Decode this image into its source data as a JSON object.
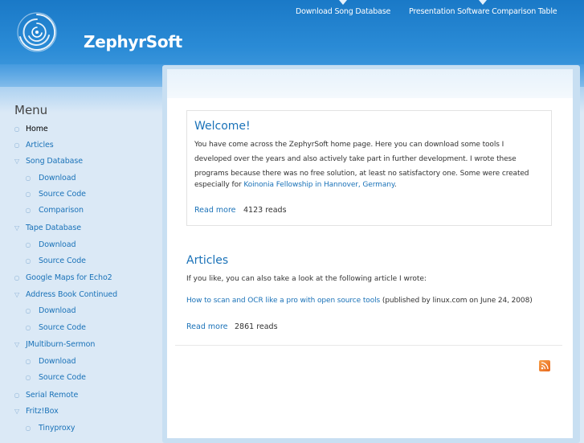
{
  "header": {
    "site_name": "ZephyrSoft",
    "logo_icon": "swirl-logo-icon",
    "primary_links": [
      {
        "label": "Download Song Database"
      },
      {
        "label": "Presentation Software Comparison Table"
      }
    ]
  },
  "sidebar": {
    "title": "Menu",
    "items": [
      {
        "label": "Home",
        "level": 0,
        "active": true,
        "expanded": false
      },
      {
        "label": "Articles",
        "level": 0
      },
      {
        "label": "Song Database",
        "level": 0,
        "expanded": true
      },
      {
        "label": "Download",
        "level": 1
      },
      {
        "label": "Source Code",
        "level": 1
      },
      {
        "label": "Comparison",
        "level": 1
      },
      {
        "label": "Tape Database",
        "level": 0,
        "expanded": true
      },
      {
        "label": "Download",
        "level": 1
      },
      {
        "label": "Source Code",
        "level": 1
      },
      {
        "label": "Google Maps for Echo2",
        "level": 0
      },
      {
        "label": "Address Book Continued",
        "level": 0,
        "expanded": true
      },
      {
        "label": "Download",
        "level": 1
      },
      {
        "label": "Source Code",
        "level": 1
      },
      {
        "label": "JMultiburn-Sermon",
        "level": 0,
        "expanded": true
      },
      {
        "label": "Download",
        "level": 1
      },
      {
        "label": "Source Code",
        "level": 1
      },
      {
        "label": "Serial Remote",
        "level": 0
      },
      {
        "label": "Fritz!Box",
        "level": 0,
        "expanded": true
      },
      {
        "label": "Tinyproxy",
        "level": 1
      }
    ]
  },
  "welcome": {
    "title": "Welcome!",
    "line1": "You have come across the ZephyrSoft home page. Here you can download some tools I",
    "line2": "developed over the years and also actively take part in further development. I wrote these",
    "line3": "programs because there was no free solution, at least no satisfactory one. Some were created",
    "line4_prefix": "especially for ",
    "line4_link": "Koinonia Fellowship in Hannover, Germany",
    "line4_suffix": ".",
    "read_more": "Read more",
    "reads": "4123 reads"
  },
  "articles": {
    "title": "Articles",
    "intro": "If you like, you can also take a look at the following article I wrote:",
    "article_link": "How to scan and OCR like a pro with open source tools",
    "article_note": " (published by linux.com on June 24, 2008)",
    "read_more": "Read more",
    "reads": "2861 reads"
  },
  "feed": {
    "icon": "rss-feed-icon"
  },
  "colors": {
    "header_blue": "#1a79c7",
    "link_blue": "#1a72b8",
    "rss_orange": "#f08a35"
  }
}
